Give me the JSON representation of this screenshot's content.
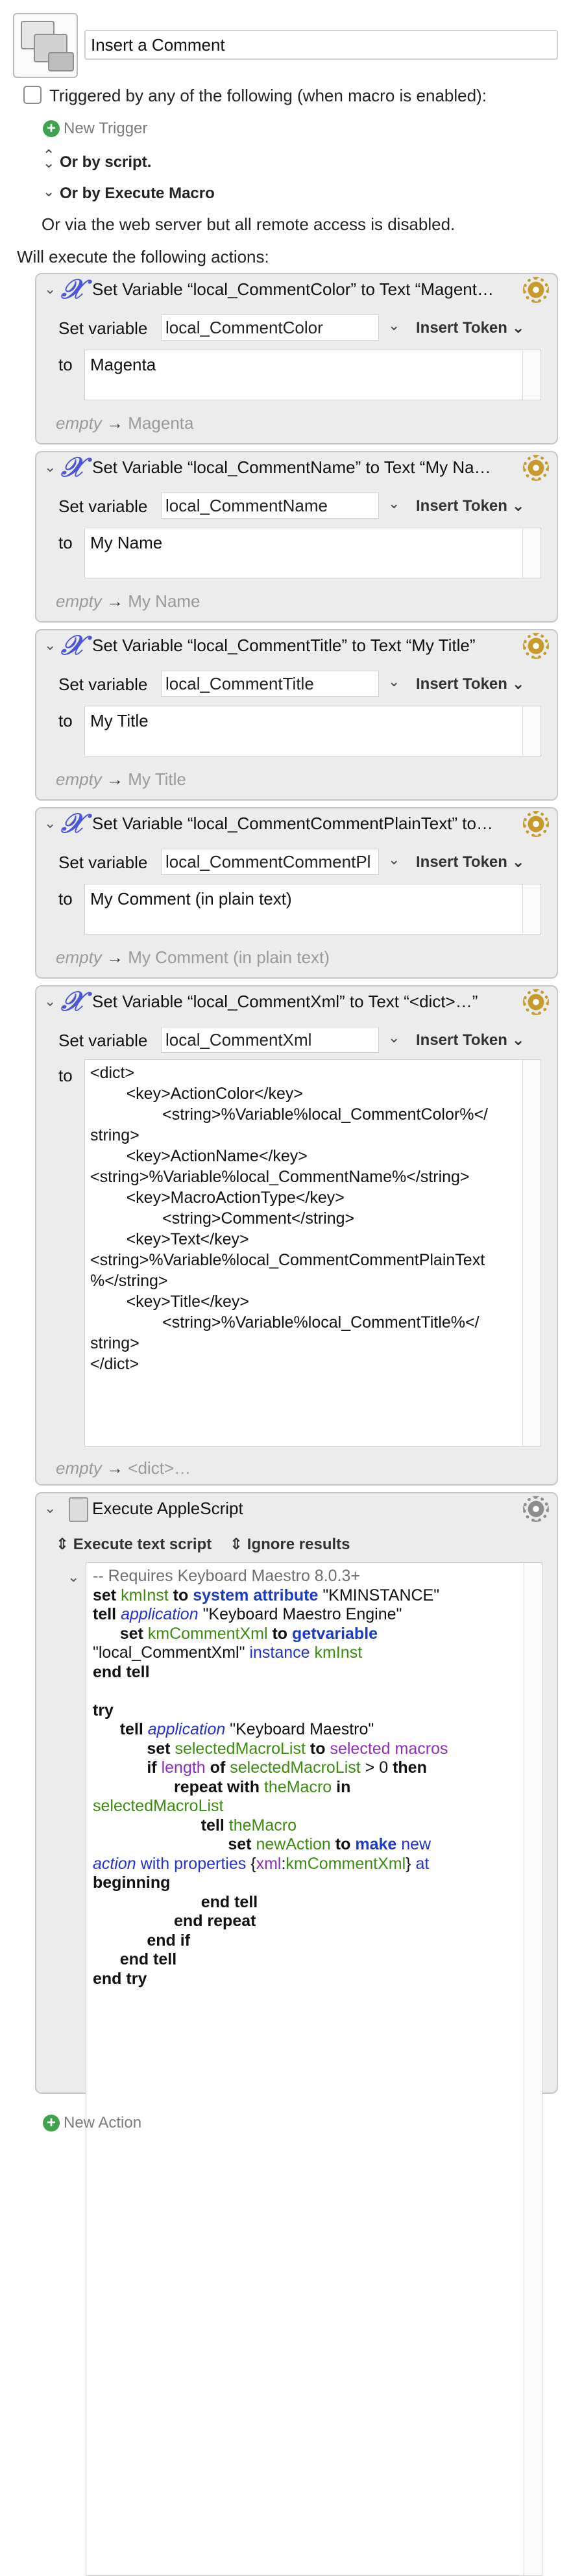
{
  "header": {
    "macro_name": "Insert a Comment",
    "triggered_label": "Triggered by any of the following (when macro is enabled):",
    "new_trigger_label": "New Trigger",
    "or_by_script": "Or by script.",
    "or_by_execute_macro": "Or by Execute Macro",
    "web_server_note": "Or via the web server but all remote access is disabled.",
    "will_execute": "Will execute the following actions:"
  },
  "actions": [
    {
      "title": "Set Variable “local_CommentColor” to Text “Magent…",
      "set_variable_label": "Set variable",
      "variable": "local_CommentColor",
      "insert_token": "Insert Token",
      "to_label": "to",
      "value": "Magenta",
      "preview_empty": "empty",
      "preview_arrow": "→",
      "preview_value": "Magenta"
    },
    {
      "title": "Set Variable “local_CommentName” to Text “My Na…",
      "set_variable_label": "Set variable",
      "variable": "local_CommentName",
      "insert_token": "Insert Token",
      "to_label": "to",
      "value": "My Name",
      "preview_empty": "empty",
      "preview_arrow": "→",
      "preview_value": "My Name"
    },
    {
      "title": "Set Variable “local_CommentTitle” to Text “My Title”",
      "set_variable_label": "Set variable",
      "variable": "local_CommentTitle",
      "insert_token": "Insert Token",
      "to_label": "to",
      "value": "My Title",
      "preview_empty": "empty",
      "preview_arrow": "→",
      "preview_value": "My Title"
    },
    {
      "title": "Set Variable “local_CommentCommentPlainText” to…",
      "set_variable_label": "Set variable",
      "variable": "local_CommentCommentPl",
      "insert_token": "Insert Token",
      "to_label": "to",
      "value": "My Comment (in plain text)",
      "preview_empty": "empty",
      "preview_arrow": "→",
      "preview_value": "My Comment (in plain text)"
    },
    {
      "title": "Set Variable “local_CommentXml” to Text “<dict>…”",
      "set_variable_label": "Set variable",
      "variable": "local_CommentXml",
      "insert_token": "Insert Token",
      "to_label": "to",
      "value_lines": [
        "<dict>",
        "        <key>ActionColor</key>",
        "                <string>%Variable%local_CommentColor%</",
        "string>",
        "        <key>ActionName</key>",
        "",
        "<string>%Variable%local_CommentName%</string>",
        "        <key>MacroActionType</key>",
        "                <string>Comment</string>",
        "        <key>Text</key>",
        "",
        "<string>%Variable%local_CommentCommentPlainText",
        "%</string>",
        "        <key>Title</key>",
        "                <string>%Variable%local_CommentTitle%</",
        "string>",
        "</dict>"
      ],
      "preview_empty": "empty",
      "preview_arrow": "→",
      "preview_value": "<dict>…"
    }
  ],
  "applescript": {
    "title": "Execute AppleScript",
    "execute_option": "Execute text script",
    "results_option": "Ignore results",
    "code": {
      "l1": "-- Requires Keyboard Maestro 8.0.3+",
      "l2a": "set",
      "l2b": "kmInst",
      "l2c": "to",
      "l2d": "system attribute",
      "l2e": "\"KMINSTANCE\"",
      "l3a": "tell",
      "l3b": "application",
      "l3c": "\"Keyboard Maestro Engine\"",
      "l4a": "set",
      "l4b": "kmCommentXml",
      "l4c": "to",
      "l4d": "getvariable",
      "l5a": "\"local_CommentXml\"",
      "l5b": "instance",
      "l5c": "kmInst",
      "l6": "end tell",
      "l8": "try",
      "l9a": "tell",
      "l9b": "application",
      "l9c": "\"Keyboard Maestro\"",
      "l10a": "set",
      "l10b": "selectedMacroList",
      "l10c": "to",
      "l10d": "selected macros",
      "l11a": "if",
      "l11b": "length",
      "l11c": "of",
      "l11d": "selectedMacroList",
      "l11e": "> 0",
      "l11f": "then",
      "l12a": "repeat with",
      "l12b": "theMacro",
      "l12c": "in",
      "l13": "selectedMacroList",
      "l14a": "tell",
      "l14b": "theMacro",
      "l15a": "set",
      "l15b": "newAction",
      "l15c": "to",
      "l15d": "make",
      "l15e": "new",
      "l16a": "action",
      "l16b": "with properties",
      "l16c": "{",
      "l16d": "xml",
      "l16e": ":",
      "l16f": "kmCommentXml",
      "l16g": "}",
      "l16h": "at",
      "l17": "beginning",
      "l18": "end tell",
      "l19": "end repeat",
      "l20": "end if",
      "l21": "end tell",
      "l22": "end try"
    }
  },
  "footer": {
    "new_action_label": "New Action"
  },
  "colors": {
    "panel_bg": "#ececec",
    "variable_icon": "#4b55d8",
    "gear": "#c89a2a",
    "plus_green": "#3ea34a",
    "keyword_blue": "#1c3bc4",
    "variable_green": "#3c8b11",
    "property_purple": "#8d2fb8"
  }
}
